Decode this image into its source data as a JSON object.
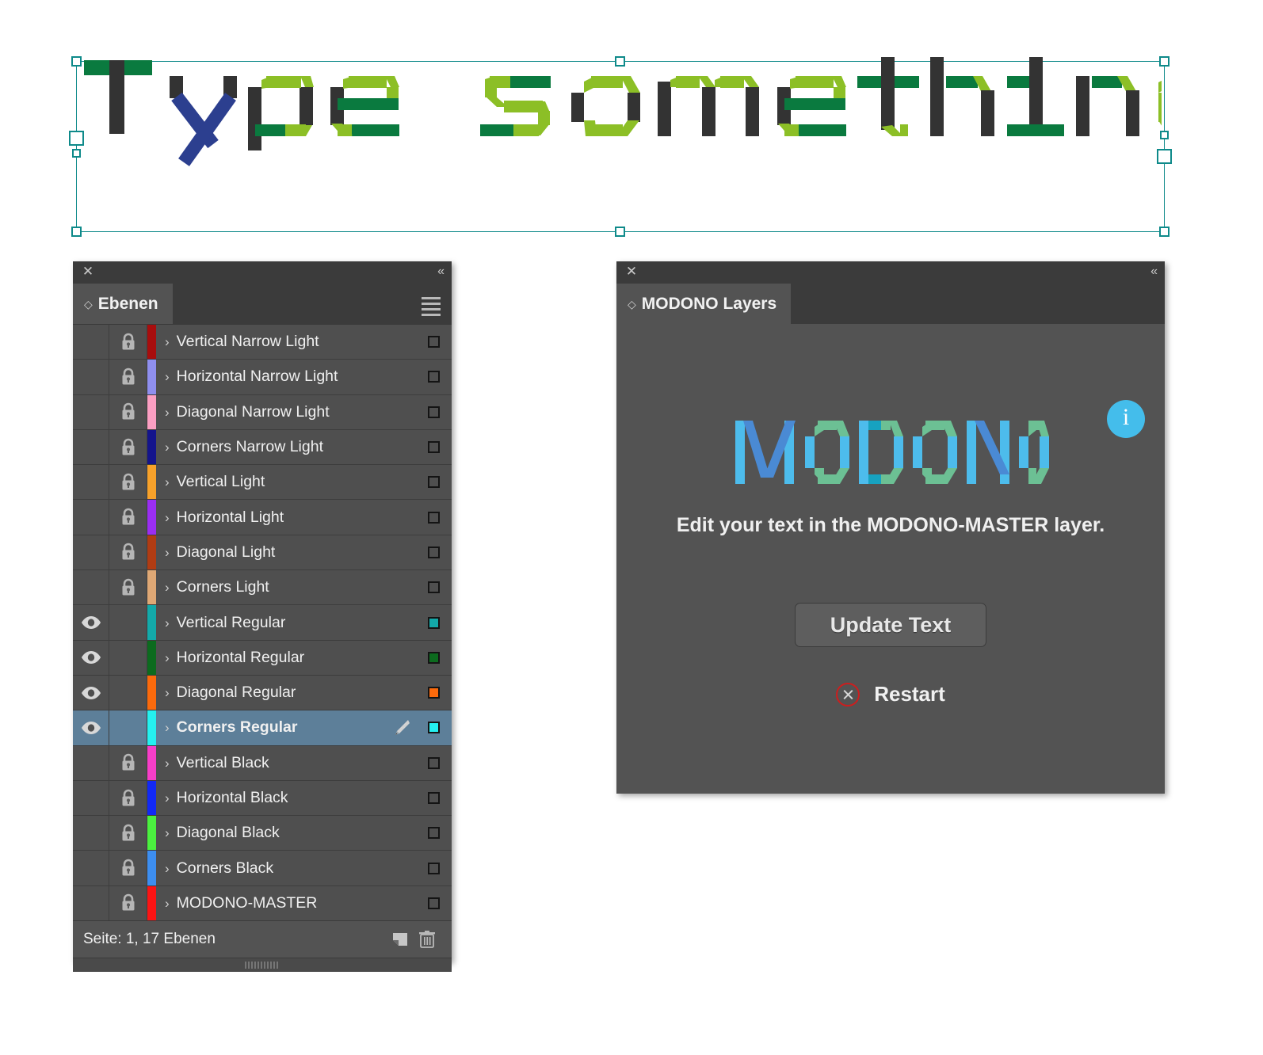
{
  "canvas": {
    "artwork_text": "Type something",
    "selection": {
      "handle_icon": "selection-handle"
    }
  },
  "layers_panel": {
    "close_icon": "close-icon",
    "collapse_icon": "collapse-double-chevron-icon",
    "menu_icon": "panel-menu-icon",
    "tab_label": "Ebenen",
    "tab_diamond_icon": "diamond-icon",
    "status_text": "Seite: 1, 17 Ebenen",
    "new_layer_icon": "new-layer-icon",
    "delete_layer_icon": "trash-icon",
    "rows": [
      {
        "name": "Vertical Narrow Light",
        "color": "#a80d0d",
        "locked": true,
        "visible": false,
        "selected": false,
        "target_filled": false
      },
      {
        "name": "Horizontal Narrow Light",
        "color": "#8f8fef",
        "locked": true,
        "visible": false,
        "selected": false,
        "target_filled": false
      },
      {
        "name": "Diagonal Narrow Light",
        "color": "#fb9fc2",
        "locked": true,
        "visible": false,
        "selected": false,
        "target_filled": false
      },
      {
        "name": "Corners Narrow Light",
        "color": "#14148c",
        "locked": true,
        "visible": false,
        "selected": false,
        "target_filled": false
      },
      {
        "name": "Vertical Light",
        "color": "#f7a12a",
        "locked": true,
        "visible": false,
        "selected": false,
        "target_filled": false
      },
      {
        "name": "Horizontal Light",
        "color": "#9b2ef2",
        "locked": true,
        "visible": false,
        "selected": false,
        "target_filled": false
      },
      {
        "name": "Diagonal Light",
        "color": "#b03c13",
        "locked": true,
        "visible": false,
        "selected": false,
        "target_filled": false
      },
      {
        "name": "Corners Light",
        "color": "#dfa875",
        "locked": true,
        "visible": false,
        "selected": false,
        "target_filled": false
      },
      {
        "name": "Vertical Regular",
        "color": "#13a9a9",
        "locked": false,
        "visible": true,
        "selected": false,
        "target_filled": true
      },
      {
        "name": "Horizontal Regular",
        "color": "#0c6b1e",
        "locked": false,
        "visible": true,
        "selected": false,
        "target_filled": true
      },
      {
        "name": "Diagonal Regular",
        "color": "#fb6a0c",
        "locked": false,
        "visible": true,
        "selected": false,
        "target_filled": true
      },
      {
        "name": "Corners Regular",
        "color": "#25f0f0",
        "locked": false,
        "visible": true,
        "selected": true,
        "target_filled": true
      },
      {
        "name": "Vertical Black",
        "color": "#f73ec8",
        "locked": true,
        "visible": false,
        "selected": false,
        "target_filled": false
      },
      {
        "name": "Horizontal Black",
        "color": "#1229f5",
        "locked": true,
        "visible": false,
        "selected": false,
        "target_filled": false
      },
      {
        "name": "Diagonal Black",
        "color": "#4bf03f",
        "locked": true,
        "visible": false,
        "selected": false,
        "target_filled": false
      },
      {
        "name": "Corners Black",
        "color": "#3d8ef0",
        "locked": true,
        "visible": false,
        "selected": false,
        "target_filled": false
      },
      {
        "name": "MODONO-MASTER",
        "color": "#fb1414",
        "locked": true,
        "visible": false,
        "selected": false,
        "target_filled": false
      }
    ]
  },
  "modono_panel": {
    "close_icon": "close-icon",
    "collapse_icon": "collapse-double-chevron-icon",
    "tab_label": "MODONO Layers",
    "tab_diamond_icon": "diamond-icon",
    "logo_text": "MODONO",
    "info_icon": "info-icon",
    "subtitle": "Edit your text in the MODONO-MASTER layer.",
    "update_button_label": "Update Text",
    "restart_label": "Restart",
    "restart_icon": "cancel-circle-icon"
  },
  "colors": {
    "artwork_dark": "#333333",
    "artwork_green_dark": "#0a7a3f",
    "artwork_green_light": "#8cbf26",
    "artwork_blue": "#2c3f8f",
    "selection_teal": "#0e8a8a",
    "logo_vertical": "#4dbcec",
    "logo_corner": "#6cc094",
    "logo_diagonal": "#4a8ad4",
    "logo_accent": "#17a2c0",
    "info_blue": "#44bdeb",
    "restart_red": "#cc1e1e",
    "selected_row": "#5d7f99"
  }
}
